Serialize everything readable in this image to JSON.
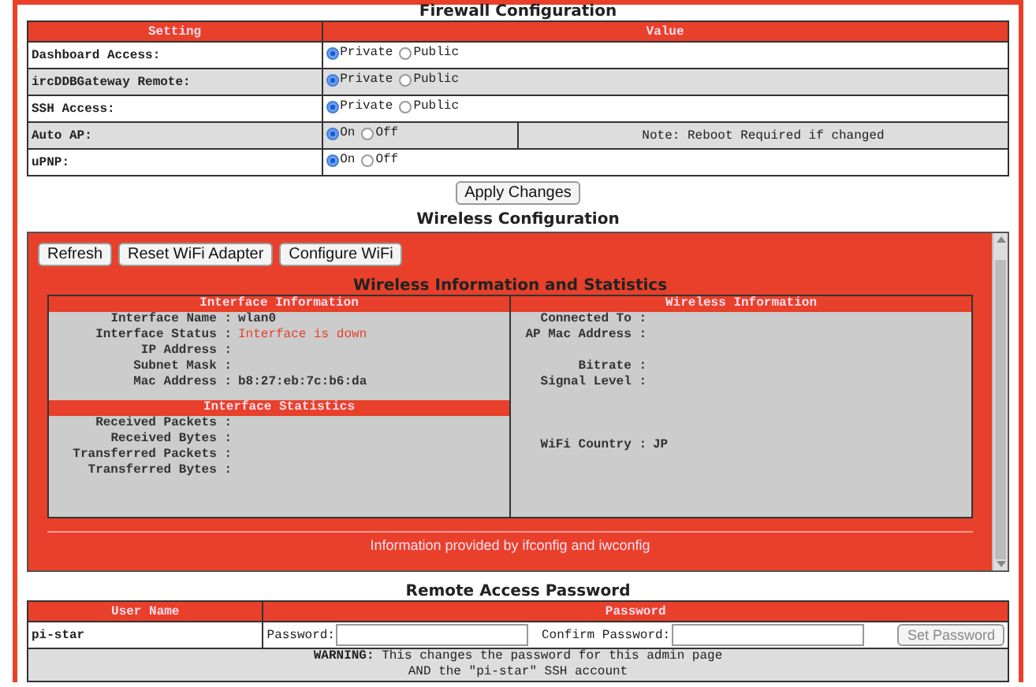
{
  "firewall": {
    "title": "Firewall Configuration",
    "columns": [
      "Setting",
      "Value"
    ],
    "rows": [
      {
        "setting": "Dashboard Access:",
        "options": [
          {
            "label": "Private",
            "selected": true
          },
          {
            "label": "Public",
            "selected": false
          }
        ]
      },
      {
        "setting": "ircDDBGateway Remote:",
        "options": [
          {
            "label": "Private",
            "selected": true
          },
          {
            "label": "Public",
            "selected": false
          }
        ]
      },
      {
        "setting": "SSH Access:",
        "options": [
          {
            "label": "Private",
            "selected": true
          },
          {
            "label": "Public",
            "selected": false
          }
        ]
      },
      {
        "setting": "Auto AP:",
        "options": [
          {
            "label": "On",
            "selected": true
          },
          {
            "label": "Off",
            "selected": false
          }
        ],
        "note": "Note: Reboot Required if changed"
      },
      {
        "setting": "uPNP:",
        "options": [
          {
            "label": "On",
            "selected": true
          },
          {
            "label": "Off",
            "selected": false
          }
        ]
      }
    ],
    "apply_button": "Apply Changes"
  },
  "wireless": {
    "title": "Wireless Configuration",
    "buttons": [
      "Refresh",
      "Reset WiFi Adapter",
      "Configure WiFi"
    ],
    "stats_title": "Wireless Information and Statistics",
    "interface_info": {
      "header": "Interface Information",
      "items": [
        {
          "label": "Interface Name :",
          "value": "wlan0",
          "alert": false
        },
        {
          "label": "Interface Status :",
          "value": "Interface is down",
          "alert": true
        },
        {
          "label": "IP Address :"
        },
        {
          "label": "Subnet Mask :"
        },
        {
          "label": "Mac Address :",
          "value": "b8:27:eb:7c:b6:da",
          "alert": false
        }
      ]
    },
    "interface_stats": {
      "header": "Interface Statistics",
      "items": [
        {
          "label": "Received Packets :"
        },
        {
          "label": "Received Bytes :"
        },
        {
          "label": "Transferred Packets :"
        },
        {
          "label": "Transferred Bytes :"
        }
      ]
    },
    "wireless_info": {
      "header": "Wireless Information",
      "items": [
        {
          "kind": "field",
          "label": "Connected To :"
        },
        {
          "kind": "field",
          "label": "AP Mac Address :"
        },
        {
          "kind": "spacer"
        },
        {
          "kind": "field",
          "label": "Bitrate :"
        },
        {
          "kind": "field",
          "label": "Signal Level :"
        },
        {
          "kind": "spacer"
        },
        {
          "kind": "spacer"
        },
        {
          "kind": "spacer"
        },
        {
          "kind": "field",
          "label": "WiFi Country :",
          "value": "JP"
        }
      ]
    },
    "footer": "Information provided by ifconfig and iwconfig"
  },
  "password": {
    "title": "Remote Access Password",
    "columns": [
      "User Name",
      "Password"
    ],
    "user": "pi-star",
    "password_label": "Password:",
    "confirm_label": "Confirm Password:",
    "set_button": {
      "label": "Set Password",
      "disabled": true
    },
    "warning_bold": "WARNING:",
    "warning": " This changes the password for this admin page",
    "warning2": "AND the \"pi-star\" SSH account"
  }
}
